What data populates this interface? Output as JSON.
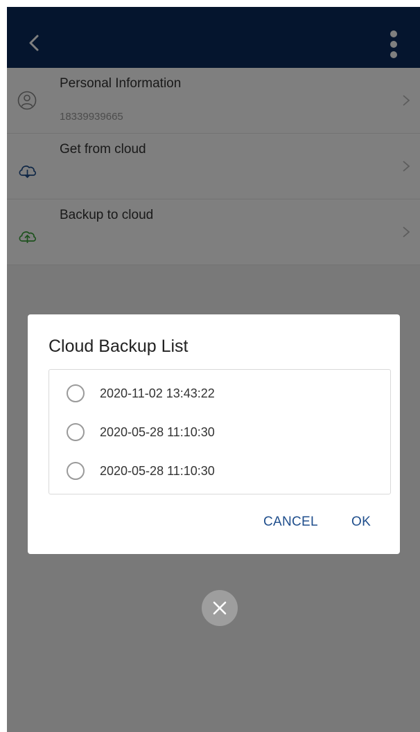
{
  "colors": {
    "navbar": "#0a2a5c",
    "accent": "#1f4e8c",
    "overlay": "rgba(0,0,0,0.5)"
  },
  "navbar": {
    "back_icon": "chevron-left-icon",
    "more_icon": "more-vertical-icon"
  },
  "list": {
    "items": [
      {
        "icon": "user-icon",
        "title": "Personal Information",
        "subtitle": "18339939665"
      },
      {
        "icon": "cloud-download-icon",
        "title": "Get from cloud",
        "subtitle": ""
      },
      {
        "icon": "cloud-upload-icon",
        "title": "Backup to cloud",
        "subtitle": ""
      }
    ]
  },
  "dialog": {
    "title": "Cloud Backup List",
    "options": [
      {
        "label": "2020-11-02 13:43:22",
        "selected": false
      },
      {
        "label": "2020-05-28 11:10:30",
        "selected": false
      },
      {
        "label": "2020-05-28 11:10:30",
        "selected": false
      }
    ],
    "cancel_label": "CANCEL",
    "ok_label": "OK"
  },
  "close_button": {
    "icon": "close-icon"
  }
}
